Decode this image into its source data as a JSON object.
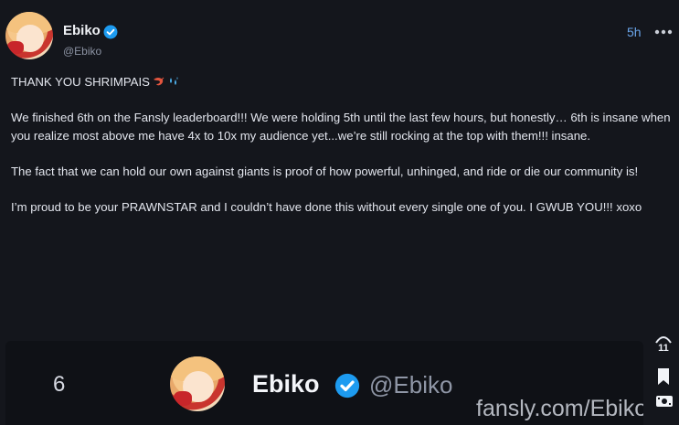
{
  "post": {
    "author": {
      "display_name": "Ebiko",
      "handle": "@Ebiko",
      "verified": true
    },
    "timestamp": "5h",
    "paragraphs": [
      "THANK YOU SHRIMPAIS",
      "We finished 6th on the Fansly leaderboard!!! We were holding 5th until the last few hours, but honestly… 6th is insane when you realize most above me have 4x to 10x my audience yet...we’re still rocking at the top with them!!! insane.",
      "The fact that we can hold our own against giants  is proof of how powerful, unhinged, and ride or die our community is!",
      "I’m proud to be your PRAWNSTAR and I couldn’t have done this without every single one of you. I GWUB YOU!!! xoxo"
    ],
    "media": {
      "rank": "6",
      "name": "Ebiko",
      "handle": "@Ebiko",
      "watermark": "fansly.com/Ebiko"
    },
    "actions": {
      "like_count": "11"
    }
  },
  "colors": {
    "background": "#14161c",
    "accent": "#1d9bf0",
    "timestamp": "#6aa5ea"
  },
  "icons": [
    "more-icon",
    "verified-icon",
    "shrimp-icon",
    "sweat-droplets-icon",
    "like-icon",
    "bookmark-icon",
    "tip-icon"
  ]
}
